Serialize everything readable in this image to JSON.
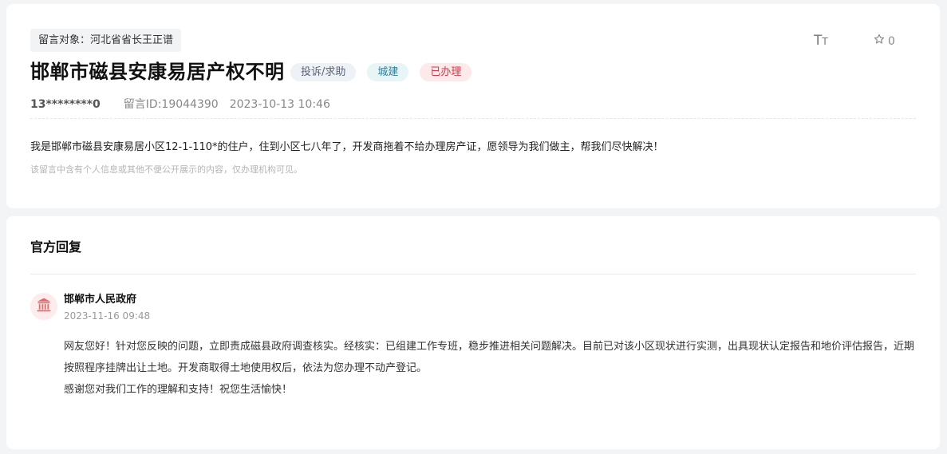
{
  "message": {
    "target_label": "留言对象：河北省省长王正谱",
    "title": "邯郸市磁县安康易居产权不明",
    "badges": {
      "type": "投诉/求助",
      "department": "城建",
      "status": "已办理"
    },
    "user": "13********0",
    "message_id": "留言ID:19044390",
    "datetime": "2023-10-13 10:46",
    "content": "我是邯郸市磁县安康易居小区12-1-110*的住户，住到小区七八年了，开发商拖着不给办理房产证，愿领导为我们做主，帮我们尽快解决！",
    "privacy_notice": "该留言中含有个人信息或其他不便公开展示的内容，仅办理机构可见。"
  },
  "toolbar": {
    "font_size_icon": "font-size-icon",
    "star_icon": "star-outline-icon",
    "star_count": "0"
  },
  "reply": {
    "section_title": "官方回复",
    "avatar_icon": "government-building-icon",
    "org_name": "邯郸市人民政府",
    "time": "2023-11-16 09:48",
    "paragraph_1": "网友您好！针对您反映的问题，立即责成磁县政府调查核实。经核实：已组建工作专班，稳步推进相关问题解决。目前已对该小区现状进行实测，出具现状认定报告和地价评估报告，近期按照程序挂牌出让土地。开发商取得土地使用权后，依法为您办理不动产登记。",
    "paragraph_2": "感谢您对我们工作的理解和支持！祝您生活愉快！"
  },
  "colors": {
    "status_red": "#d03a48",
    "dept_teal": "#2d7d9a",
    "avatar_bg": "#fdecec",
    "avatar_icon": "#e36a6a"
  }
}
